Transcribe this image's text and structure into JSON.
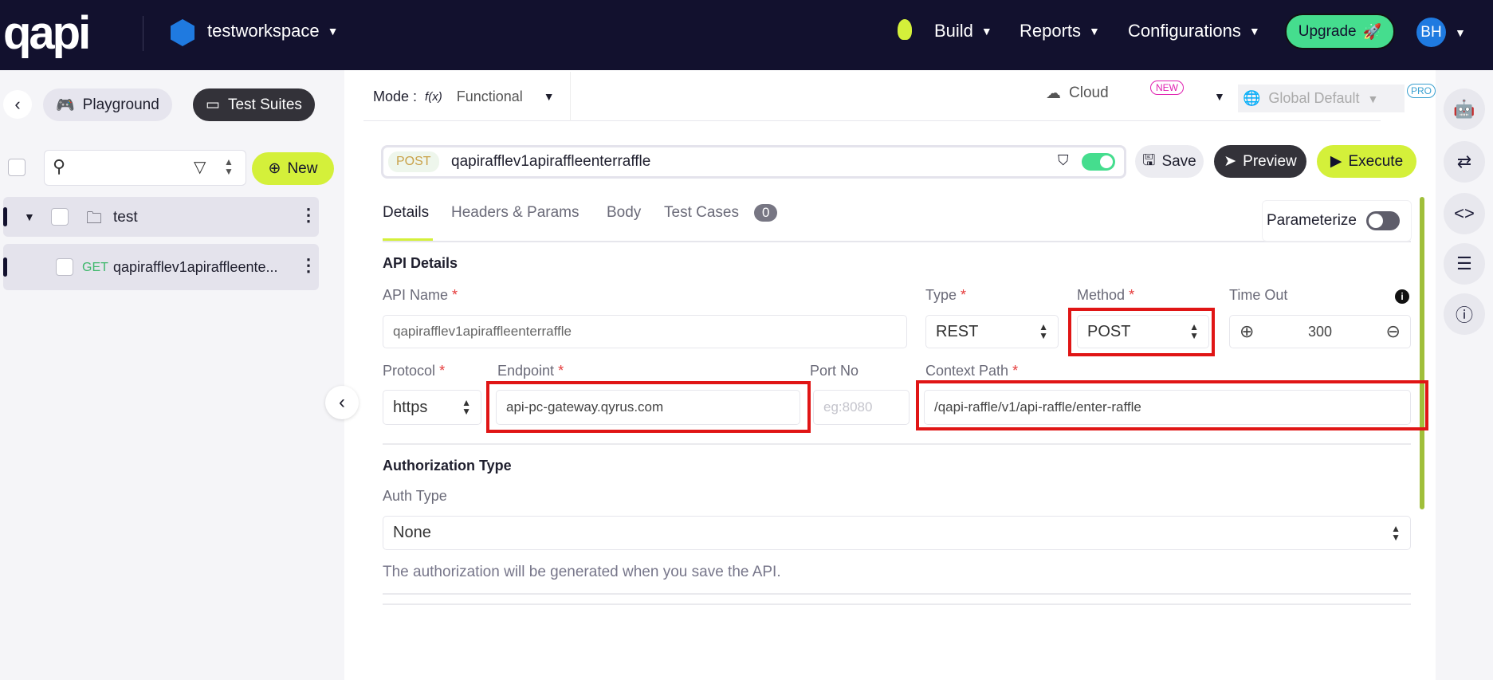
{
  "header": {
    "logo": "qapi",
    "workspace": "testworkspace",
    "nav": [
      "Build",
      "Reports",
      "Configurations"
    ],
    "upgrade": "Upgrade",
    "avatar": "BH"
  },
  "sidebar": {
    "playground": "Playground",
    "test_suites": "Test Suites",
    "new": "New",
    "folder": "test",
    "item_method": "GET",
    "item_name": "qapirafflev1apiraffleente..."
  },
  "modebar": {
    "mode_label": "Mode :",
    "mode_icon": "f(x)",
    "mode_value": "Functional",
    "cloud": "Cloud",
    "new_badge": "NEW",
    "env": "Global Default",
    "pro_badge": "PRO"
  },
  "request": {
    "method": "POST",
    "name": "qapirafflev1apiraffleenterraffle",
    "save": "Save",
    "preview": "Preview",
    "execute": "Execute"
  },
  "tabs": {
    "details": "Details",
    "headers": "Headers & Params",
    "body": "Body",
    "test_cases": "Test Cases",
    "test_cases_count": "0",
    "parameterize": "Parameterize"
  },
  "details": {
    "section": "API Details",
    "api_name_label": "API Name",
    "api_name": "qapirafflev1apiraffleenterraffle",
    "type_label": "Type",
    "type": "REST",
    "method_label": "Method",
    "method": "POST",
    "timeout_label": "Time Out",
    "timeout": "300",
    "protocol_label": "Protocol",
    "protocol": "https",
    "endpoint_label": "Endpoint",
    "endpoint": "api-pc-gateway.qyrus.com",
    "port_label": "Port No",
    "port_placeholder": "eg:8080",
    "context_label": "Context Path",
    "context": "/qapi-raffle/v1/api-raffle/enter-raffle",
    "req": "*"
  },
  "auth": {
    "section": "Authorization Type",
    "label": "Auth Type",
    "value": "None",
    "hint": "The authorization will be generated when you save the API."
  }
}
